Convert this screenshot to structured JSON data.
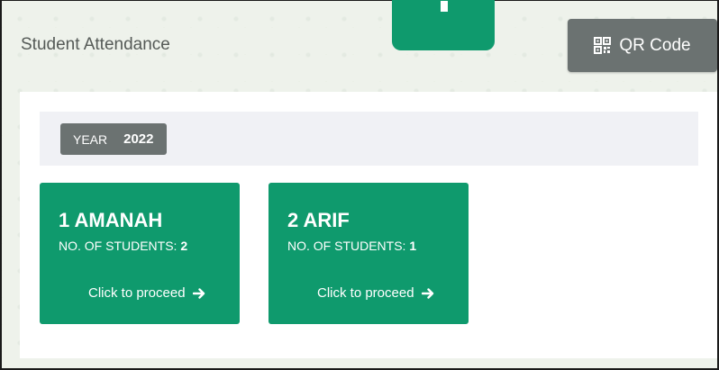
{
  "page": {
    "title": "Student Attendance",
    "qr_button_label": "QR Code"
  },
  "filter": {
    "year_label": "YEAR",
    "year_value": "2022"
  },
  "classes": [
    {
      "name": "1 AMANAH",
      "students_label": "NO. OF STUDENTS:",
      "students_count": "2",
      "action_label": "Click to proceed",
      "action_icon": "arrow-right-icon"
    },
    {
      "name": "2 ARIF",
      "students_label": "NO. OF STUDENTS:",
      "students_count": "1",
      "action_label": "Click to proceed",
      "action_icon": "arrow-right-icon"
    }
  ],
  "colors": {
    "accent": "#0f9a6d",
    "secondary": "#6b7271",
    "background": "#eef2eb"
  }
}
